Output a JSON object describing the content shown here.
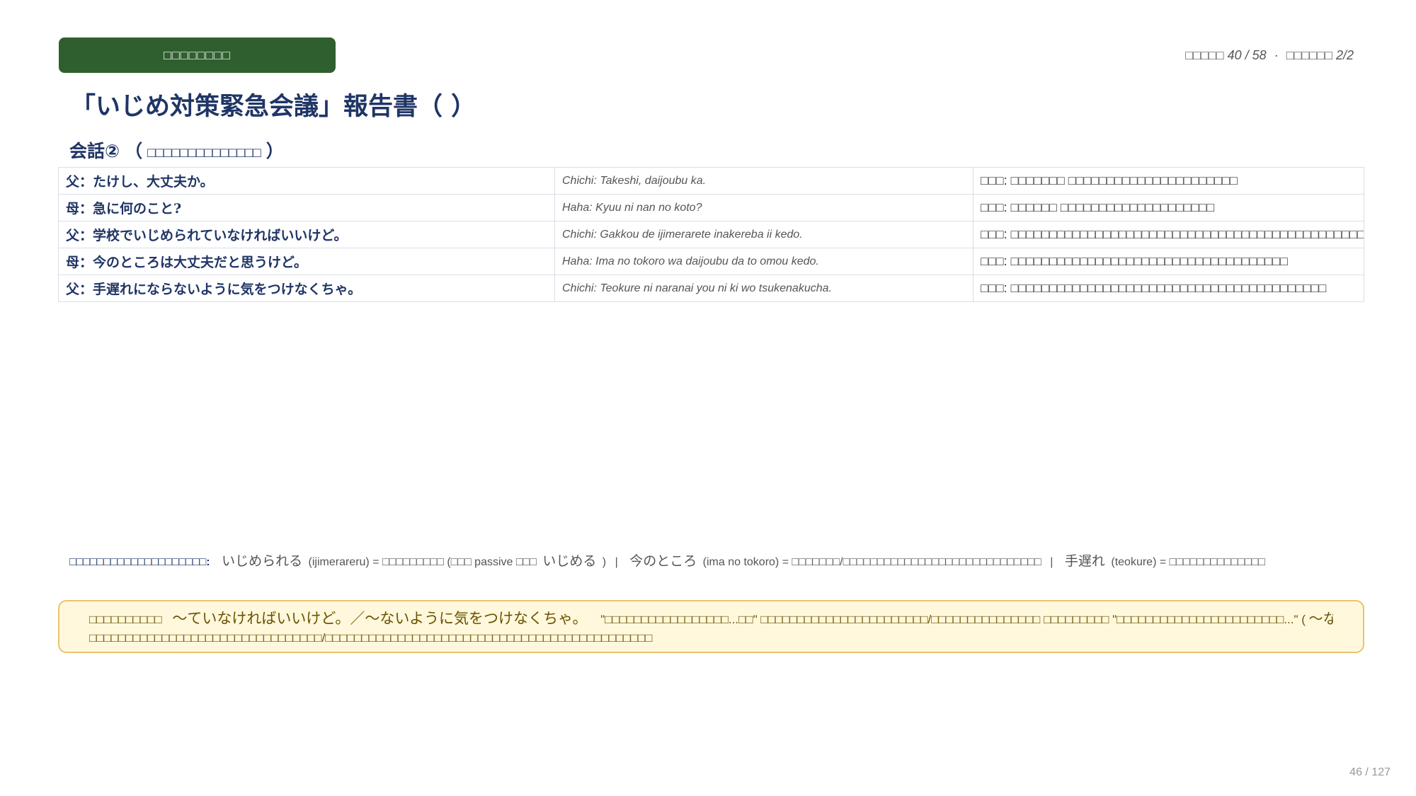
{
  "header": {
    "badge": "□□□□□□□□",
    "page_meta_a": "□□□□□ 40 / 58",
    "separator": "·",
    "page_meta_b": "□□□□□□ 2/2"
  },
  "title": "「いじめ対策緊急会議」報告書（ ）",
  "section": {
    "label": "会話②",
    "paren_open": "（",
    "paren_text": "□□□□□□□□□□□□□□",
    "paren_close": "）"
  },
  "dialogue": [
    {
      "jp": "父：たけし、大丈夫か。",
      "romaji": "Chichi: Takeshi, daijoubu ka.",
      "translation": "□□□: □□□□□□□ □□□□□□□□□□□□□□□□□□□□□□"
    },
    {
      "jp": "母：急に何のこと?",
      "romaji": "Haha: Kyuu ni nan no koto?",
      "translation": "□□□: □□□□□□ □□□□□□□□□□□□□□□□□□□□"
    },
    {
      "jp": "父：学校でいじめられていなければいいけど。",
      "romaji": "Chichi: Gakkou de ijimerarete inakereba ii kedo.",
      "translation": "□□□: □□□□□□□□□□□□□□□□□□□□□□□□□□□□□□□□□□□□□□□□□□□□□□□□□□□□□□□□□"
    },
    {
      "jp": "母：今のところは大丈夫だと思うけど。",
      "romaji": "Haha: Ima no tokoro wa daijoubu da to omou kedo.",
      "translation": "□□□: □□□□□□□□□□□□□□□□□□□□□□□□□□□□□□□□□□□□"
    },
    {
      "jp": "父：手遅れにならないように気をつけなくちゃ。",
      "romaji": "Chichi: Teokure ni naranai you ni ki wo tsukenakucha.",
      "translation": "□□□: □□□□□□□□□□□□□□□□□□□□□□□□□□□□□□□□□□□□□□□□□"
    }
  ],
  "vocab": {
    "label": "□□□□□□□□□□□□□□□□□□□□:",
    "v1_word": "いじめられる",
    "v1_rest": "(ijimerareru) = □□□□□□□□□ (□□□ passive □□□",
    "v1_base": "いじめる",
    "v1_close": ")",
    "v2_word": "今のところ",
    "v2_rest": "(ima no tokoro) = □□□□□□□/□□□□□□□□□□□□□□□□□□□□□□□□□□□□□",
    "v3_word": "手遅れ",
    "v3_rest": "(teokure) = □□□□□□□□□□□□□□",
    "bar": "|"
  },
  "grammar": {
    "label": "□□□□□□□□□□",
    "pattern": "〜ていなければいいけど。／〜ないように気をつけなくちゃ。",
    "text_a": "\"□□□□□□□□□□□□□□□□□...□□\" □□□□□□□□□□□□□□□□□□□□□□□/□□□□□□□□□□□□□□□ □□□□□□□□□ \"□□□□□□□□□□□□□□□□□□□□□□□...\" (",
    "text_pattern": "〜ないように気をつける",
    "text_b": ") □□□□",
    "line2": "□□□□□□□□□□□□□□□□□□□□□□□□□□□□□□□□/□□□□□□□□□□□□□□□□□□□□□□□□□□□□□□□□□□□□□□□□□□□□□"
  },
  "footer": {
    "slide_counter": "46 / 127"
  },
  "colors": {
    "badge_bg": "#2f5f2f",
    "title": "#1f3566",
    "grammar_bg": "#fff8dc",
    "grammar_border": "#e9c46a"
  }
}
